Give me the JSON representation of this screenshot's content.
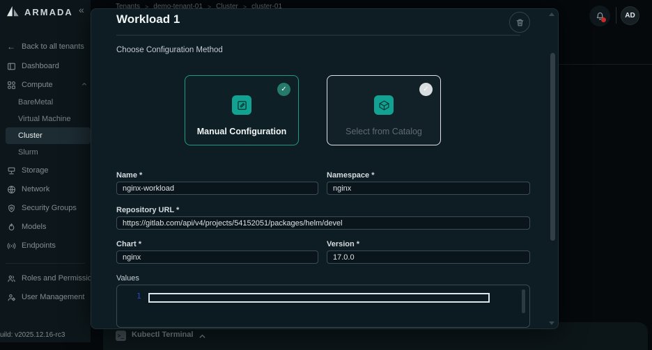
{
  "colors": {
    "accent_teal": "#12a291",
    "selected_card_border": "#1d9a89",
    "notification_dot": "#c92a2a",
    "line_number_blue": "#2946c8"
  },
  "sidebar": {
    "logo": "ARMADA",
    "collapse_glyph": "«",
    "back_glyph": "←",
    "back": "Back to all tenants",
    "dashboard": "Dashboard",
    "compute": "Compute",
    "baremetal": "BareMetal",
    "virtual_machine": "Virtual Machine",
    "cluster": "Cluster",
    "slurm": "Slurm",
    "storage": "Storage",
    "network": "Network",
    "security_groups": "Security Groups",
    "models": "Models",
    "endpoints": "Endpoints",
    "roles_permissions": "Roles and Permissions",
    "user_management": "User Management",
    "build": "uild: v2025.12.16-rc3"
  },
  "header": {
    "breadcrumb": [
      "Tenants",
      "demo-tenant-01",
      "Cluster",
      "cluster-01"
    ],
    "breadcrumb_sep": ">",
    "avatar_initials": "AD"
  },
  "modal": {
    "title": "Workload 1",
    "config_method_label": "Choose Configuration Method",
    "manual_card": {
      "label": "Manual Configuration",
      "check": "✓"
    },
    "catalog_card": {
      "label": "Select from Catalog",
      "check": "✓"
    },
    "fields": {
      "name_label": "Name *",
      "name_value": "nginx-workload",
      "namespace_label": "Namespace *",
      "namespace_value": "nginx",
      "repo_label": "Repository URL *",
      "repo_value": "https://gitlab.com/api/v4/projects/54152051/packages/helm/devel",
      "chart_label": "Chart *",
      "chart_value": "nginx",
      "version_label": "Version *",
      "version_value": "17.0.0"
    },
    "values_label": "Values",
    "editor_line_number": "1"
  },
  "terminal": {
    "icon_glyph": "&gt;_",
    "label": "Kubectl Terminal"
  }
}
